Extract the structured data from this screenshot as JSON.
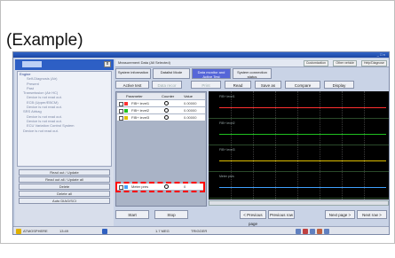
{
  "caption": "(Example)",
  "window": {
    "title_controls": "_ □ ×"
  },
  "left_panel": {
    "close_label": "x",
    "tree": [
      {
        "label": "Engine",
        "selected": true
      },
      {
        "label": "Self-Diagnosis (Air)",
        "selected": false
      },
      {
        "label": "Present",
        "selected": false
      },
      {
        "label": "Past",
        "selected": false
      },
      {
        "label": "Transmission (Air HC)",
        "selected": false
      },
      {
        "label": "Device is not read out.",
        "selected": false
      },
      {
        "label": "ECB (Upper/EBCM)",
        "selected": false
      },
      {
        "label": "Device is not read out.",
        "selected": false
      },
      {
        "label": "SRS Airbag",
        "selected": false
      },
      {
        "label": "Device is not read out.",
        "selected": false
      },
      {
        "label": "Device is not read out.",
        "selected": false
      },
      {
        "label": "ECU Variation Control System",
        "selected": false
      },
      {
        "label": "Device is not read out.",
        "selected": false
      }
    ],
    "buttons": [
      "Read out / Update",
      "Read out all / Update all",
      "Delete",
      "Delete all",
      "Auto DIAG/SCI"
    ]
  },
  "right_panel": {
    "top_title": "Measurement Data (All Selected)",
    "top_buttons": [
      "Customization",
      "Other vehicle",
      "Help/Diagnose"
    ],
    "tabs": [
      "System information",
      "Datalist Mode",
      "Data monitor and Active Test",
      "System connection status"
    ],
    "toolbar": [
      "Active test",
      "Data recor",
      "Print",
      "Read",
      "Save as",
      "Compare",
      "Display"
    ],
    "param_header": {
      "name": "Parameter",
      "unit": "Counter",
      "value": "Value"
    },
    "params": [
      {
        "name": "FIB+ level1",
        "value": "0.00000",
        "color": "#ff3030"
      },
      {
        "name": "FIB+ level2",
        "value": "0.00000",
        "color": "#20c020"
      },
      {
        "name": "FIB+ level3",
        "value": "0.00000",
        "color": "#e0c000"
      },
      {
        "name": "Meter pres",
        "value": "0",
        "color": "#40a0ff"
      }
    ],
    "graph_labels": [
      "FIB+ level1",
      "FIB+ level2",
      "FIB+ level3",
      "Meter pres"
    ],
    "bottom_buttons": [
      "Start",
      "Stop",
      "< Previous page",
      "Previous row",
      "Next page >",
      "Next row >"
    ]
  },
  "taskbar": {
    "items": [
      "ATMOSPHERE",
      "13:49",
      "1.7 MEG",
      "TRIGGER"
    ]
  },
  "colors": {
    "highlight_dash": "#ff0000",
    "active_tab": "#5566d8",
    "graph_bg": "#000000"
  }
}
